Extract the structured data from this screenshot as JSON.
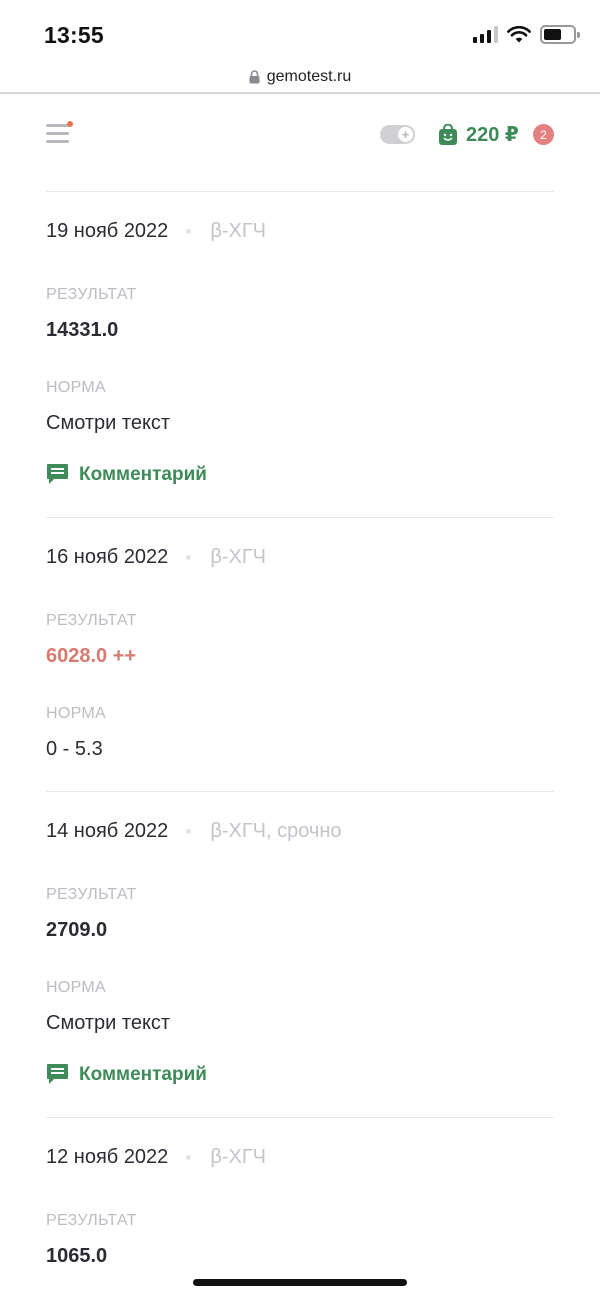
{
  "status_bar": {
    "time": "13:55",
    "signal_icon": "signal-bars-icon",
    "wifi_icon": "wifi-icon",
    "battery_icon": "battery-icon"
  },
  "browser": {
    "url": "gemotest.ru",
    "lock_icon": "lock-icon"
  },
  "header": {
    "cart_price": "220 ₽",
    "cart_count": "2",
    "cart_icon": "shopping-bag-icon",
    "menu_icon": "hamburger-menu-icon"
  },
  "colors": {
    "accent_green": "#3e8a58",
    "abnormal_red": "#d77a70",
    "badge_red": "#e38080",
    "notification_orange": "#e8734a"
  },
  "labels": {
    "result": "РЕЗУЛЬТАТ",
    "norm": "НОРМА",
    "comment": "Комментарий"
  },
  "entries": [
    {
      "date": "19 нояб 2022",
      "test": "β-ХГЧ",
      "result": "14331.0",
      "norm": "Смотри текст",
      "has_comment": true
    },
    {
      "date": "16 нояб 2022",
      "test": "β-ХГЧ",
      "result": "6028.0 ++",
      "norm": "0 - 5.3",
      "has_comment": false
    },
    {
      "date": "14 нояб 2022",
      "test": "β-ХГЧ, срочно",
      "result": "2709.0",
      "norm": "Смотри текст",
      "has_comment": true
    },
    {
      "date": "12 нояб 2022",
      "test": "β-ХГЧ",
      "result": "1065.0"
    }
  ]
}
